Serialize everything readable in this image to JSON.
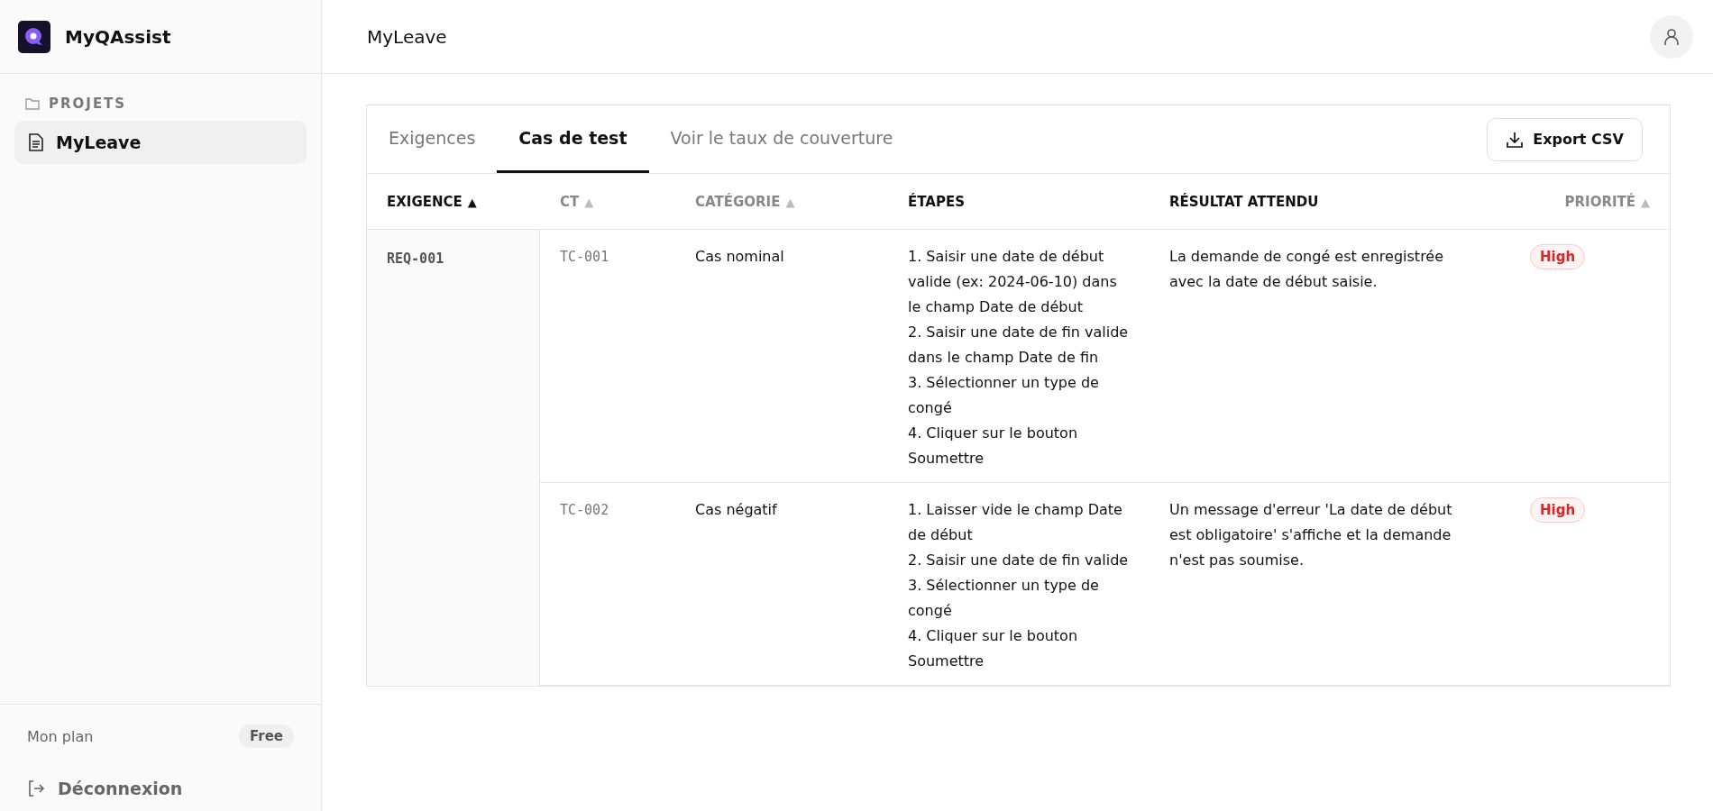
{
  "app": {
    "name": "MyQAssist"
  },
  "sidebar": {
    "section": "PROJETS",
    "items": [
      {
        "label": "MyLeave",
        "selected": true
      }
    ],
    "plan_label": "Mon plan",
    "plan_badge": "Free",
    "logout": "Déconnexion"
  },
  "header": {
    "title": "MyLeave"
  },
  "tabs": [
    {
      "label": "Exigences",
      "selected": false
    },
    {
      "label": "Cas de test",
      "selected": true
    },
    {
      "label": "Voir le taux de couverture",
      "selected": false
    }
  ],
  "export_button": "Export CSV",
  "table": {
    "columns": [
      {
        "label": "EXIGENCE",
        "sort": "▲",
        "active": true
      },
      {
        "label": "CT",
        "sort": "▲",
        "active": false
      },
      {
        "label": "CATÉGORIE",
        "sort": "▲",
        "active": false
      },
      {
        "label": "ÉTAPES",
        "active": true
      },
      {
        "label": "RÉSULTAT ATTENDU",
        "active": true
      },
      {
        "label": "PRIORITÉ",
        "sort": "▲",
        "active": false
      }
    ],
    "groups": [
      {
        "requirement": "REQ-001",
        "rows": [
          {
            "id": "TC-001",
            "category": "Cas nominal",
            "steps": [
              "1. Saisir une date de début valide (ex: 2024-06-10) dans le champ Date de début",
              "2. Saisir une date de fin valide dans le champ Date de fin",
              "3. Sélectionner un type de congé",
              "4. Cliquer sur le bouton Soumettre"
            ],
            "expected": "La demande de congé est enregistrée avec la date de début saisie.",
            "priority": "High"
          },
          {
            "id": "TC-002",
            "category": "Cas négatif",
            "steps": [
              "1. Laisser vide le champ Date de début",
              "2. Saisir une date de fin valide",
              "3. Sélectionner un type de congé",
              "4. Cliquer sur le bouton Soumettre"
            ],
            "expected": "Un message d'erreur 'La date de début est obligatoire' s'affiche et la demande n'est pas soumise.",
            "priority": "High"
          }
        ]
      }
    ]
  }
}
